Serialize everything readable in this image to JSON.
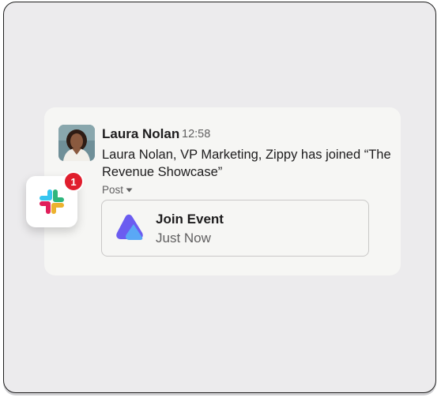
{
  "message": {
    "author": "Laura Nolan",
    "time": "12:58",
    "text": "Laura Nolan, VP Marketing, Zippy has joined “The Revenue Showcase”",
    "post_menu_label": "Post"
  },
  "event_card": {
    "title": "Join Event",
    "subtitle": "Just Now",
    "logo_icon": "event-logo-icon"
  },
  "app": {
    "icon": "slack-logo-icon",
    "badge_count": "1",
    "badge_color": "#e01e2d"
  },
  "colors": {
    "frame_background": "#ecebed",
    "card_background": "#f6f6f4",
    "text_primary": "#1d1c1d",
    "text_secondary": "#616061",
    "event_logo_purple": "#6b5cf0",
    "event_logo_blue": "#5aa8f5"
  }
}
